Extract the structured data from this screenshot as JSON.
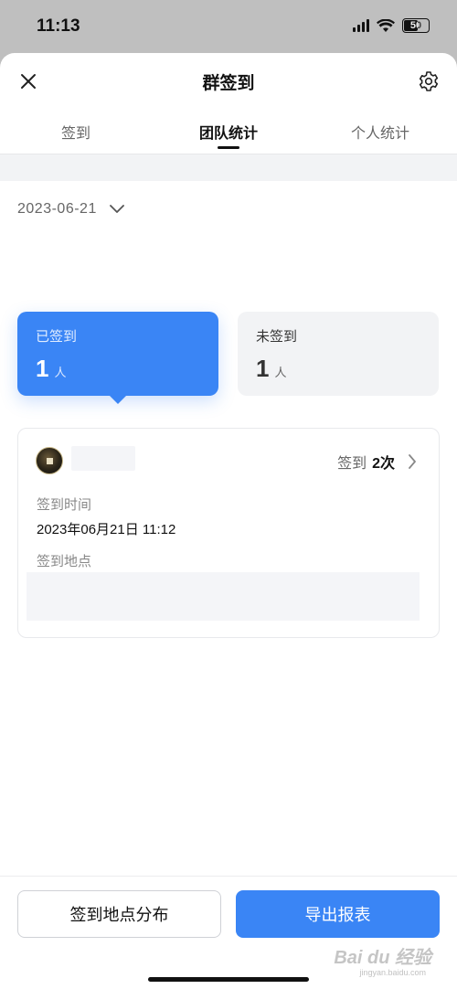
{
  "status_bar": {
    "time": "11:13",
    "battery": "50"
  },
  "header": {
    "title": "群签到",
    "close_icon": "close-icon",
    "settings_icon": "gear-icon"
  },
  "tabs": [
    {
      "label": "签到",
      "active": false
    },
    {
      "label": "团队统计",
      "active": true
    },
    {
      "label": "个人统计",
      "active": false
    }
  ],
  "date_picker": {
    "value": "2023-06-21"
  },
  "stats": {
    "signed": {
      "label": "已签到",
      "count": "1",
      "unit": "人"
    },
    "unsigned": {
      "label": "未签到",
      "count": "1",
      "unit": "人"
    }
  },
  "record": {
    "checkin_prefix": "签到",
    "checkin_times": "2次",
    "time_label": "签到时间",
    "time_value": "2023年06月21日 11:12",
    "location_label": "签到地点"
  },
  "actions": {
    "map_button": "签到地点分布",
    "export_button": "导出报表"
  },
  "watermark": {
    "text": "Bai du 经验",
    "sub": "jingyan.baidu.com"
  },
  "colors": {
    "accent": "#3a85f5",
    "muted_bg": "#f2f3f5"
  }
}
